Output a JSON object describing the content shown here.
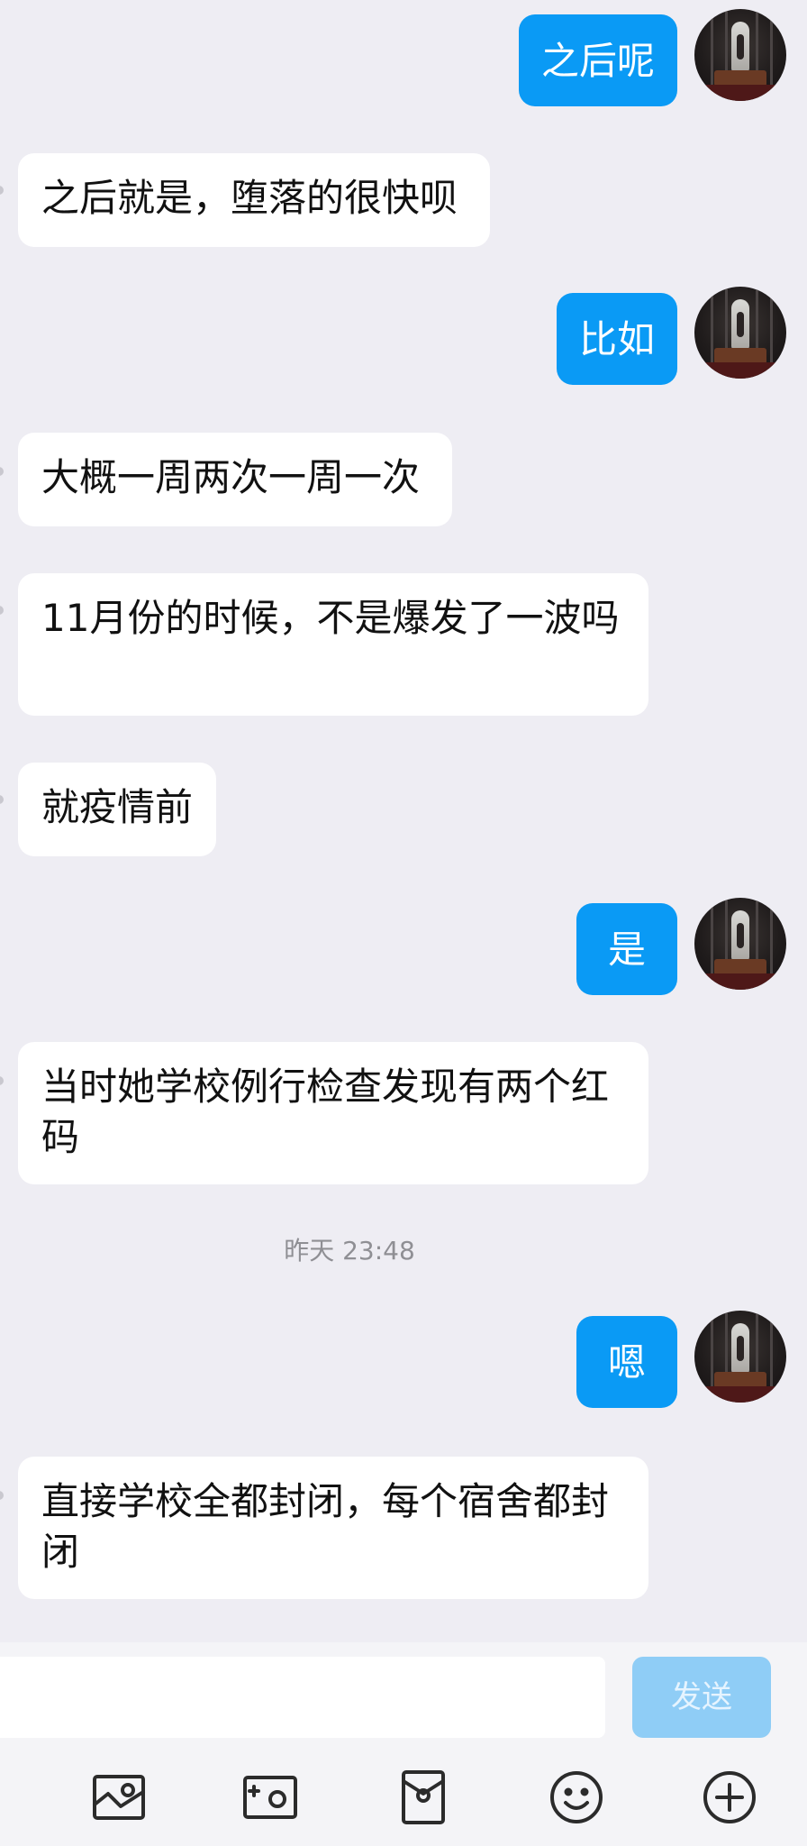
{
  "messages": [
    {
      "side": "out",
      "text": "之后呢"
    },
    {
      "side": "in",
      "text": "之后就是，堕落的很快呗"
    },
    {
      "side": "out",
      "text": "比如"
    },
    {
      "side": "in",
      "text": "大概一周两次一周一次"
    },
    {
      "side": "in",
      "text": "11月份的时候，不是爆发了一波吗"
    },
    {
      "side": "in",
      "text": "就疫情前"
    },
    {
      "side": "out",
      "text": "是"
    },
    {
      "side": "in",
      "text": "当时她学校例行检查发现有两个红码"
    },
    {
      "side": "out",
      "text": "嗯"
    },
    {
      "side": "in",
      "text": "直接学校全都封闭，每个宿舍都封闭"
    }
  ],
  "timestamp": "昨天 23:48",
  "input": {
    "value": "",
    "placeholder": ""
  },
  "send_label": "发送",
  "toolbar": {
    "icons": [
      "image-icon",
      "camera-icon",
      "red-envelope-icon",
      "emoji-icon",
      "plus-icon"
    ]
  },
  "colors": {
    "background": "#eeedf3",
    "outgoing_bubble": "#0a9af5",
    "incoming_bubble": "#ffffff",
    "send_button_disabled": "#8fcdf6"
  }
}
